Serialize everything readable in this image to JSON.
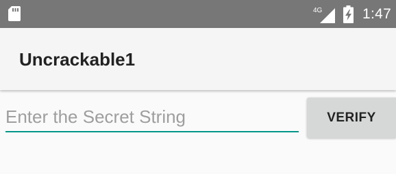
{
  "status_bar": {
    "network_type": "4G",
    "time": "1:47",
    "icons": [
      "sd-card-icon",
      "cellular-signal-icon",
      "battery-charging-icon"
    ],
    "background_color": "#777777"
  },
  "app_bar": {
    "title": "Uncrackable1"
  },
  "main": {
    "secret_input": {
      "value": "",
      "placeholder": "Enter the Secret String",
      "accent_color": "#009688"
    },
    "verify_button": {
      "label": "VERIFY"
    }
  }
}
